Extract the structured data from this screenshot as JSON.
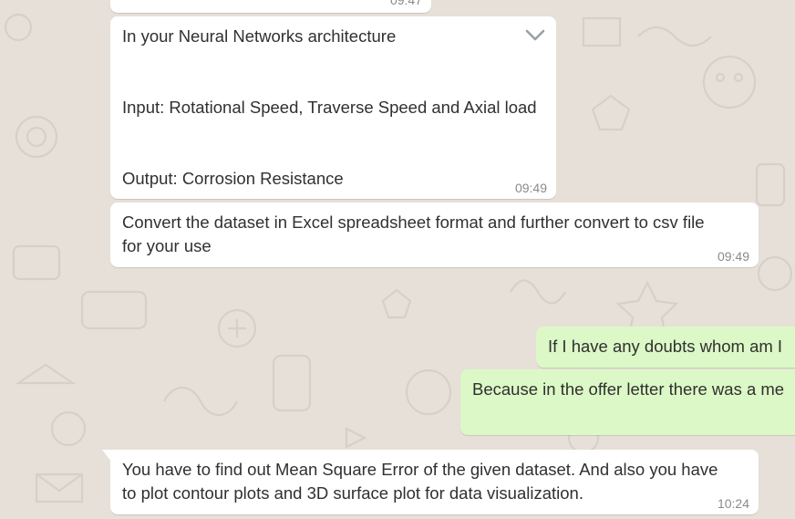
{
  "chat": {
    "background_color": "#e7e0d8",
    "incoming_color": "#ffffff",
    "outgoing_color": "#dcf8c6",
    "messages": [
      {
        "direction": "incoming",
        "text": "",
        "time": "09:47"
      },
      {
        "direction": "incoming",
        "lines": [
          "In your Neural Networks architecture",
          "Input: Rotational Speed, Traverse Speed and Axial load",
          "Output: Corrosion Resistance"
        ],
        "time": "09:49",
        "menu_icon": "chevron-down-icon"
      },
      {
        "direction": "incoming",
        "lines": [
          "Convert the dataset in Excel spreadsheet format and further convert to csv file",
          "for your use"
        ],
        "time": "09:49"
      },
      {
        "direction": "outgoing",
        "lines": [
          "If I have any doubts whom am I"
        ]
      },
      {
        "direction": "outgoing",
        "lines": [
          "Because in the offer letter there was a me"
        ]
      },
      {
        "direction": "incoming",
        "lines": [
          "You have to find out Mean Square Error of the given dataset. And also you have",
          "to plot contour plots and 3D surface plot for data visualization."
        ],
        "time": "10:24"
      }
    ]
  }
}
